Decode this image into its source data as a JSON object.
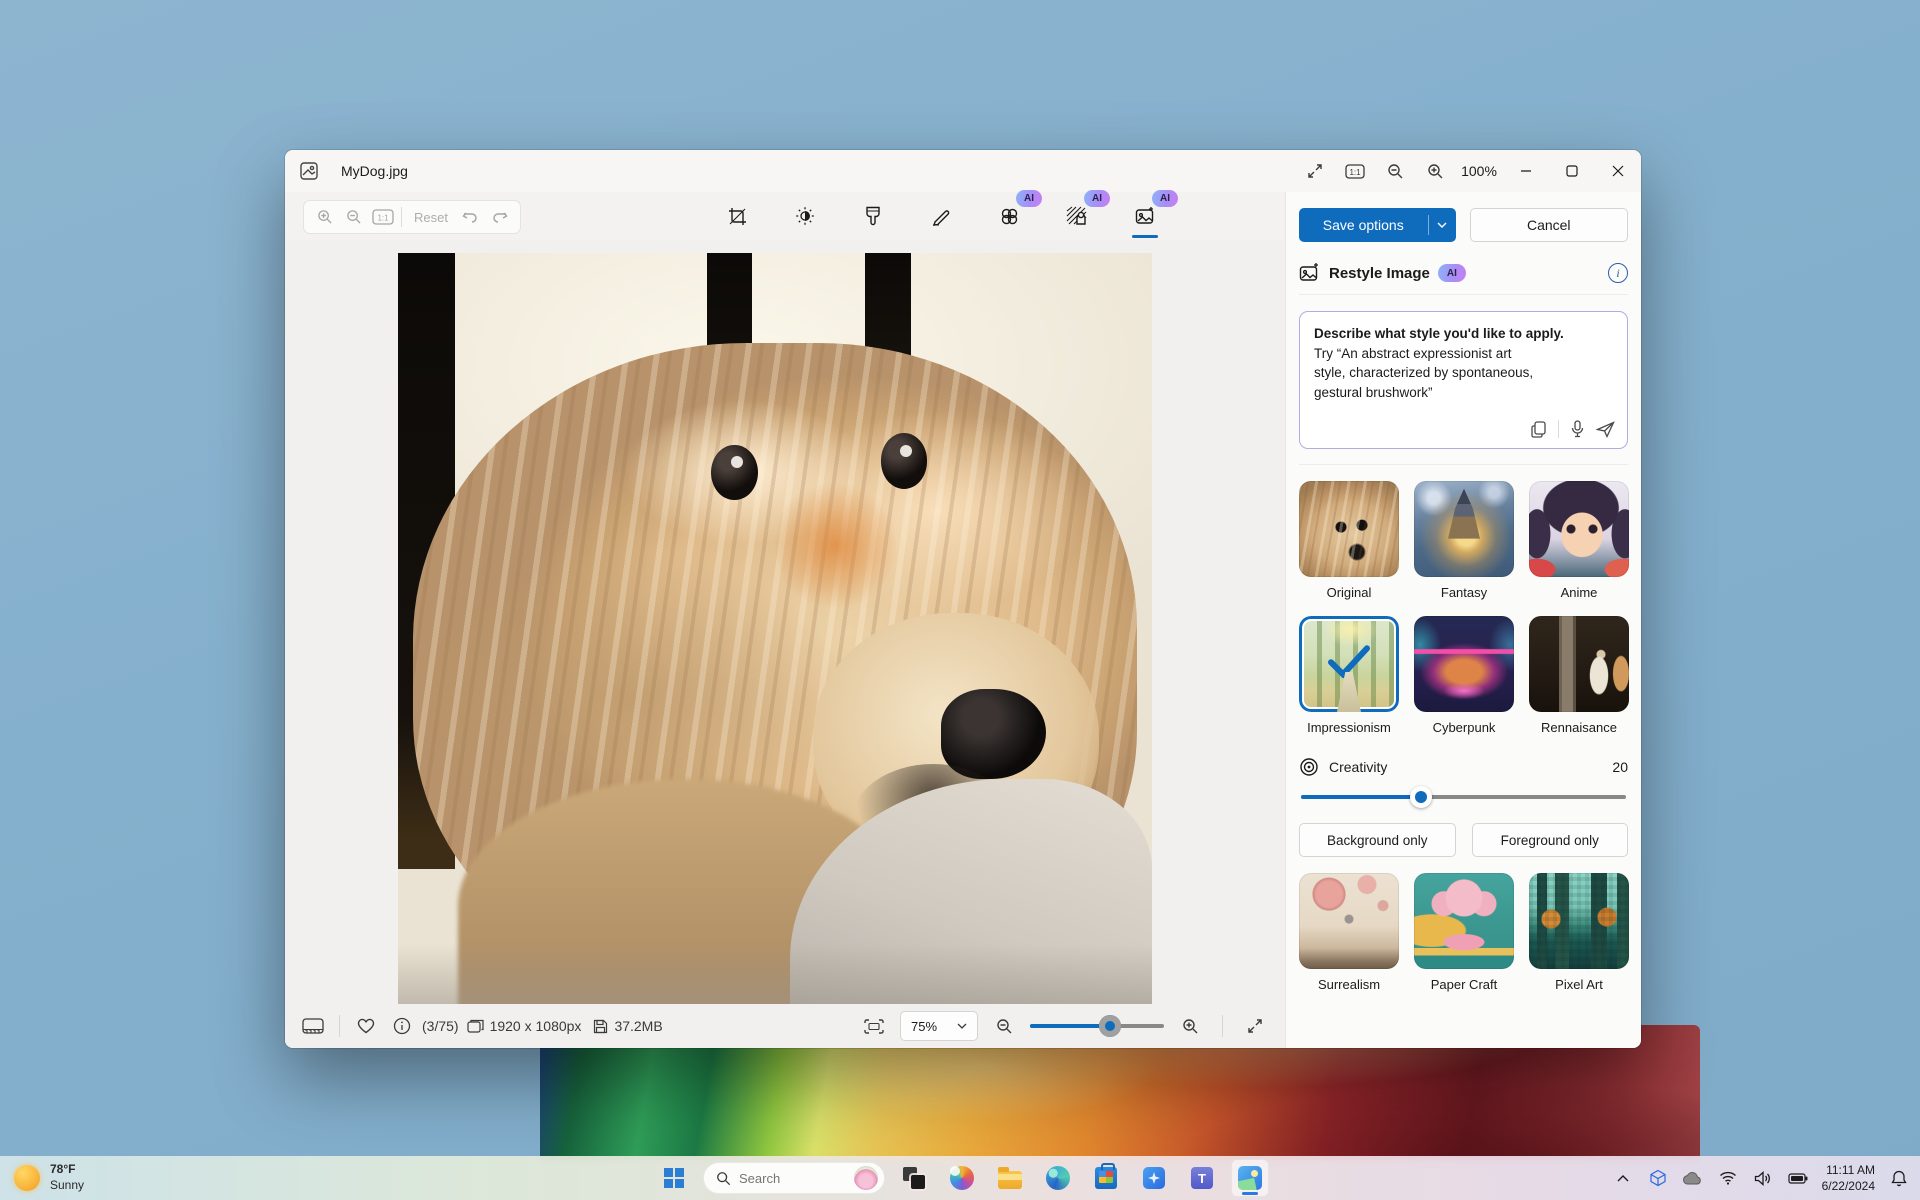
{
  "window": {
    "title": "MyDog.jpg",
    "zoom_percent": "100%",
    "toolbar": {
      "reset": "Reset"
    },
    "actions": {
      "save": "Save options",
      "cancel": "Cancel"
    }
  },
  "restyle": {
    "title": "Restyle Image",
    "ai_badge": "AI",
    "prompt_heading": "Describe what style you'd like to apply.",
    "prompt_hint": "Try “An abstract expressionist art style, characterized by spontaneous, gestural brushwork”",
    "styles": [
      {
        "label": "Original",
        "selected": false
      },
      {
        "label": "Fantasy",
        "selected": false
      },
      {
        "label": "Anime",
        "selected": false
      },
      {
        "label": "Impressionism",
        "selected": true
      },
      {
        "label": "Cyberpunk",
        "selected": false
      },
      {
        "label": "Rennaisance",
        "selected": false
      },
      {
        "label": "Surrealism",
        "selected": false
      },
      {
        "label": "Paper Craft",
        "selected": false
      },
      {
        "label": "Pixel Art",
        "selected": false
      }
    ],
    "creativity": {
      "label": "Creativity",
      "value": "20"
    },
    "scope_buttons": {
      "background": "Background only",
      "foreground": "Foreground only"
    }
  },
  "statusbar": {
    "position": "(3/75)",
    "dimensions": "1920 x 1080px",
    "filesize": "37.2MB",
    "zoom_value": "75%"
  },
  "taskbar": {
    "weather": {
      "temp": "78°F",
      "condition": "Sunny"
    },
    "search": {
      "placeholder": "Search"
    },
    "clock": {
      "time": "11:11 AM",
      "date": "6/22/2024"
    }
  },
  "colors": {
    "accent": "#0F6CBD",
    "ai_badge_start": "#8AB4F8",
    "ai_badge_end": "#C77FF2",
    "sky": "#85B0CD"
  }
}
